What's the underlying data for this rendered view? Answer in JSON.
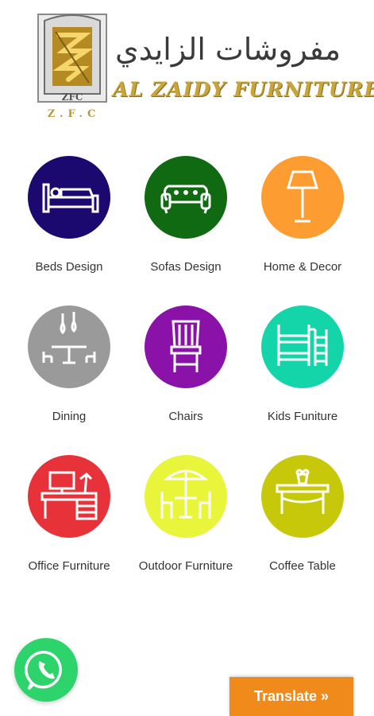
{
  "brand": {
    "arabic_name": "مفروشات الزايدي",
    "english_name": "AL ZAIDY FURNITURE",
    "initials": "Z.F.C"
  },
  "categories": [
    {
      "label": "Beds Design",
      "color": "#1c0970",
      "icon": "bed-icon"
    },
    {
      "label": "Sofas Design",
      "color": "#0f6a12",
      "icon": "sofa-icon"
    },
    {
      "label": "Home & Decor",
      "color": "#fd9c30",
      "icon": "lamp-icon"
    },
    {
      "label": "Dining",
      "color": "#9a9a9a",
      "icon": "dining-icon"
    },
    {
      "label": "Chairs",
      "color": "#8a12a8",
      "icon": "chair-icon"
    },
    {
      "label": "Kids Funiture",
      "color": "#14d4aa",
      "icon": "bunk-bed-icon"
    },
    {
      "label": "Office Furniture",
      "color": "#e8323a",
      "icon": "desk-icon"
    },
    {
      "label": "Outdoor Furniture",
      "color": "#e8f53a",
      "icon": "patio-icon"
    },
    {
      "label": "Coffee Table",
      "color": "#c8c80a",
      "icon": "coffee-table-icon"
    }
  ],
  "translate": {
    "label": "Translate »",
    "color": "#f08a1a"
  },
  "whatsapp": {
    "color": "#2cd46b",
    "icon": "whatsapp-icon"
  }
}
